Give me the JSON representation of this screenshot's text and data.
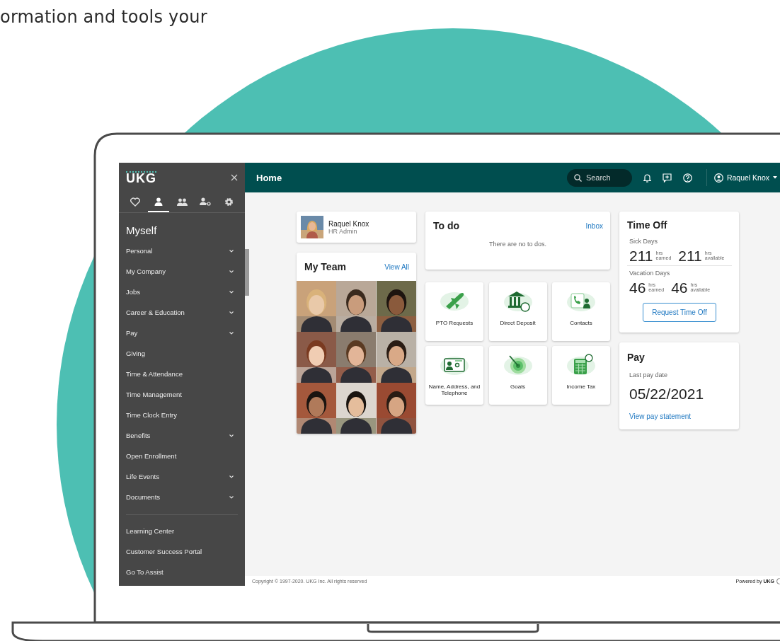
{
  "headline": "ormation and tools your",
  "sidebar": {
    "logo": "UKG",
    "tabs": [
      {
        "kind": "heart",
        "selected": false
      },
      {
        "kind": "person",
        "selected": true
      },
      {
        "kind": "people",
        "selected": false
      },
      {
        "kind": "personkey",
        "selected": false
      },
      {
        "kind": "gear",
        "selected": false
      }
    ],
    "heading": "Myself",
    "items": [
      {
        "label": "Personal",
        "expandable": true
      },
      {
        "label": "My Company",
        "expandable": true
      },
      {
        "label": "Jobs",
        "expandable": true
      },
      {
        "label": "Career & Education",
        "expandable": true
      },
      {
        "label": "Pay",
        "expandable": true
      },
      {
        "label": "Giving",
        "expandable": false
      },
      {
        "label": "Time & Attendance",
        "expandable": false
      },
      {
        "label": "Time Management",
        "expandable": false
      },
      {
        "label": "Time Clock Entry",
        "expandable": false
      },
      {
        "label": "Benefits",
        "expandable": true
      },
      {
        "label": "Open Enrollment",
        "expandable": false
      },
      {
        "label": "Life Events",
        "expandable": true
      },
      {
        "label": "Documents",
        "expandable": true
      }
    ],
    "links": [
      "Learning Center",
      "Customer Success Portal",
      "Go To Assist"
    ]
  },
  "header": {
    "title": "Home",
    "search": {
      "placeholder": "Search"
    },
    "user": "Raquel Knox"
  },
  "profile": {
    "name": "Raquel Knox",
    "role": "HR Admin"
  },
  "team": {
    "title": "My Team",
    "link": "View All"
  },
  "todo": {
    "title": "To do",
    "link": "Inbox",
    "empty": "There are no to dos."
  },
  "tiles": [
    {
      "label": "PTO Requests",
      "kind": "plane"
    },
    {
      "label": "Direct Deposit",
      "kind": "bank"
    },
    {
      "label": "Contacts",
      "kind": "phone"
    },
    {
      "label": "Name, Address, and Telephone",
      "kind": "idcard"
    },
    {
      "label": "Goals",
      "kind": "target"
    },
    {
      "label": "Income Tax",
      "kind": "calculator"
    }
  ],
  "time_off": {
    "title": "Time Off",
    "sections": [
      {
        "label": "Sick Days",
        "stats": [
          {
            "value": "211",
            "unit": "hrs",
            "caption": "earned"
          },
          {
            "value": "211",
            "unit": "hrs",
            "caption": "available"
          }
        ]
      },
      {
        "label": "Vacation Days",
        "stats": [
          {
            "value": "46",
            "unit": "hrs",
            "caption": "earned"
          },
          {
            "value": "46",
            "unit": "hrs",
            "caption": "available"
          }
        ]
      }
    ],
    "button": "Request Time Off"
  },
  "pay": {
    "title": "Pay",
    "label": "Last pay date",
    "date": "05/22/2021",
    "link": "View pay statement"
  },
  "footer": {
    "copyright": "Copyright © 1997-2020. UKG Inc. All rights reserved",
    "powered": "Powered by **UKG**"
  }
}
